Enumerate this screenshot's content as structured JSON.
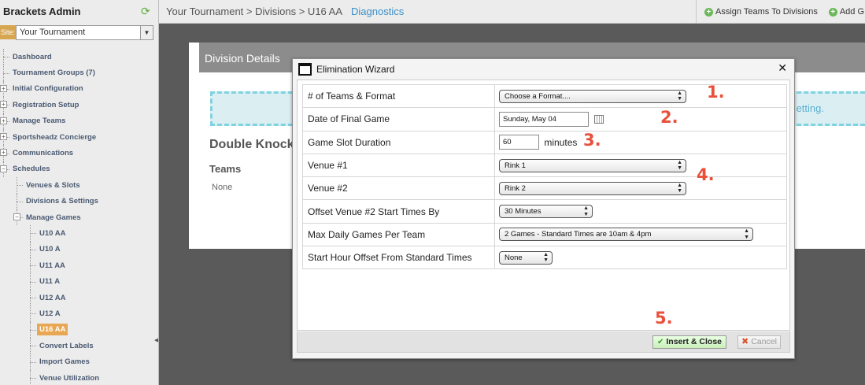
{
  "sidebar": {
    "title": "Brackets Admin",
    "site_label": "Site:",
    "site_value": "Your Tournament",
    "items": [
      {
        "label": "Dashboard",
        "level": 0
      },
      {
        "label": "Tournament Groups (7)",
        "level": 0
      },
      {
        "label": "Initial Configuration",
        "level": 0
      },
      {
        "label": "Registration Setup",
        "level": 0
      },
      {
        "label": "Manage Teams",
        "level": 0
      },
      {
        "label": "Sportsheadz Concierge",
        "level": 0
      },
      {
        "label": "Communications",
        "level": 0
      },
      {
        "label": "Schedules",
        "level": 0
      },
      {
        "label": "Venues & Slots",
        "level": 1
      },
      {
        "label": "Divisions & Settings",
        "level": 1
      },
      {
        "label": "Manage Games",
        "level": 1
      },
      {
        "label": "U10 AA",
        "level": 2
      },
      {
        "label": "U10 A",
        "level": 2
      },
      {
        "label": "U11 AA",
        "level": 2
      },
      {
        "label": "U11 A",
        "level": 2
      },
      {
        "label": "U12 AA",
        "level": 2
      },
      {
        "label": "U12 A",
        "level": 2
      },
      {
        "label": "U16 AA",
        "level": 2
      },
      {
        "label": "Convert Labels",
        "level": 2
      },
      {
        "label": "Import Games",
        "level": 2
      },
      {
        "label": "Venue Utilization",
        "level": 2
      }
    ]
  },
  "topbar": {
    "breadcrumb": "Your Tournament > Divisions > U16 AA",
    "diagnostics": "Diagnostics",
    "assign_teams": "Assign Teams To Divisions",
    "add": "Add G"
  },
  "background": {
    "panel_title": "Division Details",
    "dashed_text": "etting.",
    "heading": "Double Knock",
    "teams_label": "Teams",
    "teams_value": "None"
  },
  "modal": {
    "title": "Elimination Wizard",
    "rows": {
      "teams_format": {
        "label": "# of Teams & Format",
        "value": "Choose a Format...."
      },
      "final_date": {
        "label": "Date of Final Game",
        "value": "Sunday, May 04"
      },
      "slot_duration": {
        "label": "Game Slot Duration",
        "value": "60",
        "unit": "minutes"
      },
      "venue1": {
        "label": "Venue #1",
        "value": "Rink 1"
      },
      "venue2": {
        "label": "Venue #2",
        "value": "Rink 2"
      },
      "offset_venue2": {
        "label": "Offset Venue #2 Start Times By",
        "value": "30 Minutes"
      },
      "max_daily": {
        "label": "Max Daily Games Per Team",
        "value": "2 Games - Standard Times are 10am & 4pm"
      },
      "start_hour_offset": {
        "label": "Start Hour Offset From Standard Times",
        "value": "None"
      }
    },
    "annotations": [
      "1.",
      "2.",
      "3.",
      "4.",
      "5."
    ],
    "insert_label": "Insert & Close",
    "cancel_label": "Cancel"
  },
  "colors": {
    "accent_active": "#e8a752",
    "link_blue": "#3a8fc8",
    "annotation_red": "#e8503a",
    "overlay_gray": "#5a5a5a"
  }
}
